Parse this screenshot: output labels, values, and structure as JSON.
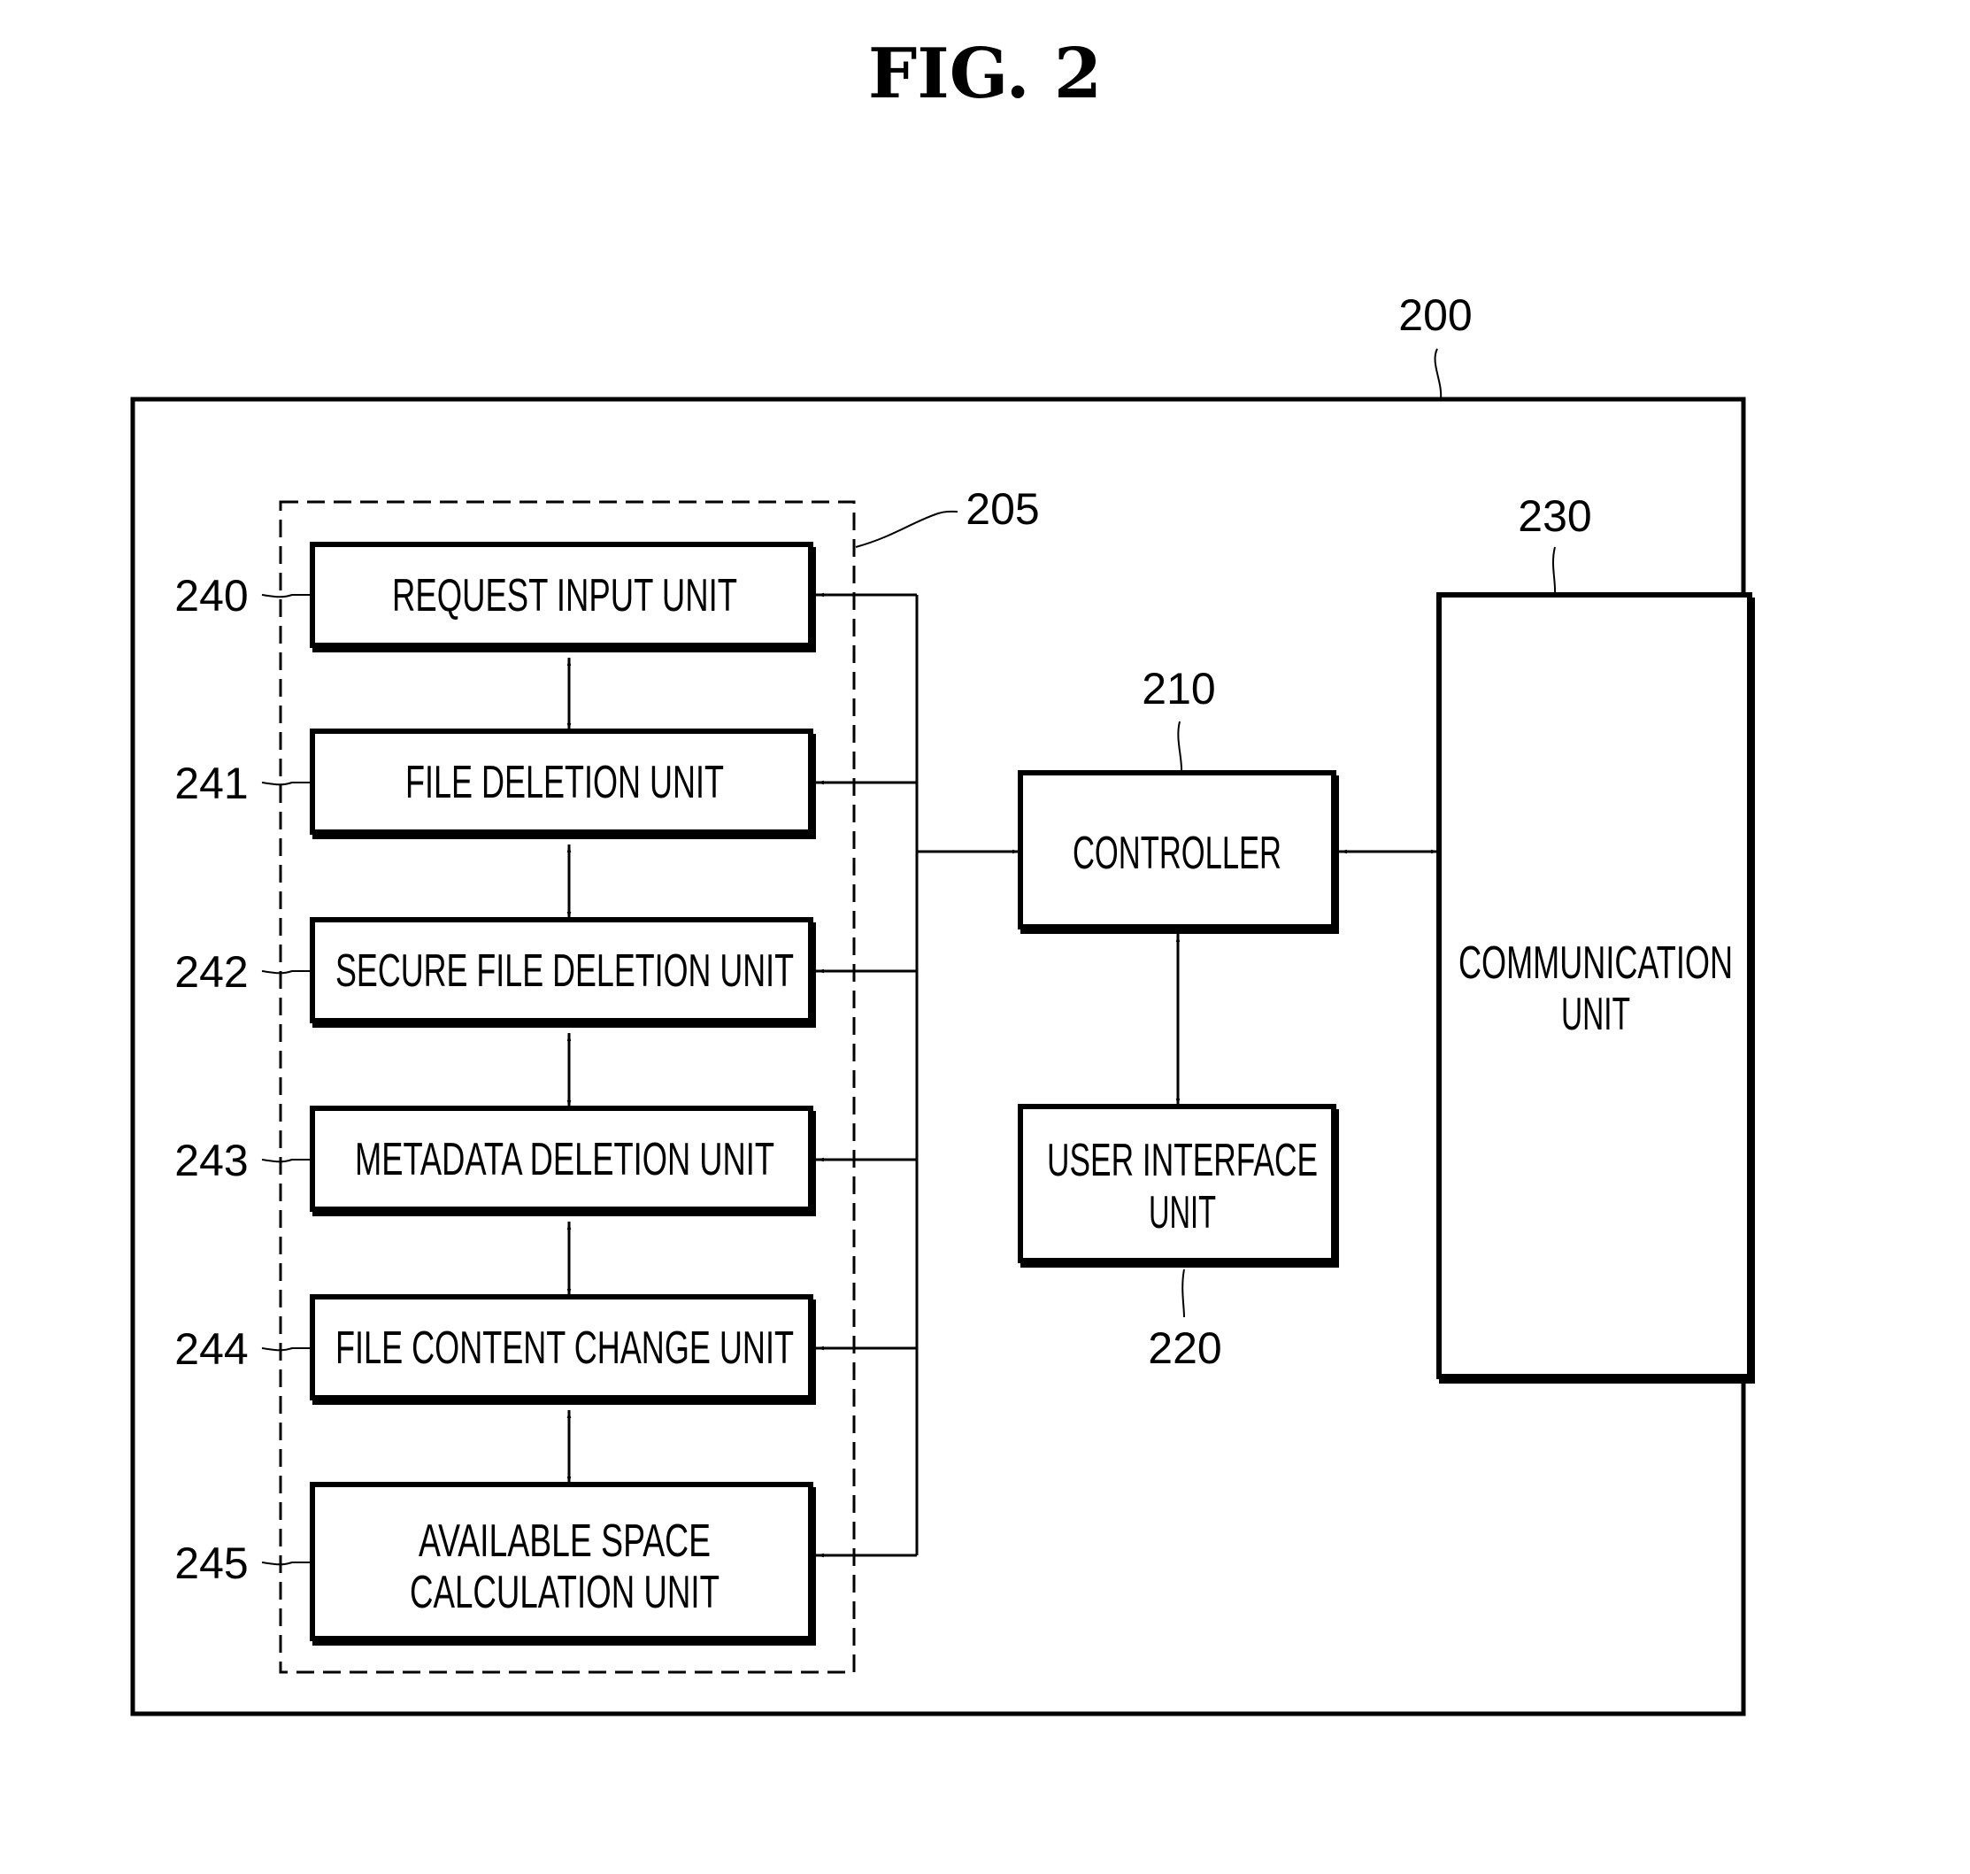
{
  "figure": {
    "title": "FIG. 2"
  },
  "device": {
    "ref": "200",
    "group": {
      "ref": "205",
      "units": [
        {
          "ref": "240",
          "lines": [
            "REQUEST INPUT UNIT"
          ]
        },
        {
          "ref": "241",
          "lines": [
            "FILE DELETION UNIT"
          ]
        },
        {
          "ref": "242",
          "lines": [
            "SECURE FILE DELETION UNIT"
          ]
        },
        {
          "ref": "243",
          "lines": [
            "METADATA DELETION UNIT"
          ]
        },
        {
          "ref": "244",
          "lines": [
            "FILE CONTENT CHANGE UNIT"
          ]
        },
        {
          "ref": "245",
          "lines": [
            "AVAILABLE SPACE",
            "CALCULATION UNIT"
          ]
        }
      ]
    },
    "controller": {
      "ref": "210",
      "lines": [
        "CONTROLLER"
      ]
    },
    "user_interface": {
      "ref": "220",
      "lines": [
        "USER INTERFACE",
        "UNIT"
      ]
    },
    "communication": {
      "ref": "230",
      "lines": [
        "COMMUNICATION",
        "UNIT"
      ]
    }
  },
  "connections": [
    {
      "from": "controller",
      "to": "240",
      "type": "bus"
    },
    {
      "from": "controller",
      "to": "241",
      "type": "bus"
    },
    {
      "from": "controller",
      "to": "242",
      "type": "bus"
    },
    {
      "from": "controller",
      "to": "243",
      "type": "bus"
    },
    {
      "from": "controller",
      "to": "244",
      "type": "bus"
    },
    {
      "from": "controller",
      "to": "245",
      "type": "bus"
    },
    {
      "from": "240",
      "to": "241",
      "type": "bidirectional"
    },
    {
      "from": "241",
      "to": "242",
      "type": "bidirectional"
    },
    {
      "from": "242",
      "to": "243",
      "type": "bidirectional"
    },
    {
      "from": "243",
      "to": "244",
      "type": "bidirectional"
    },
    {
      "from": "244",
      "to": "245",
      "type": "bidirectional"
    },
    {
      "from": "controller",
      "to": "communication",
      "type": "bidirectional"
    },
    {
      "from": "controller",
      "to": "user_interface",
      "type": "bidirectional"
    }
  ]
}
